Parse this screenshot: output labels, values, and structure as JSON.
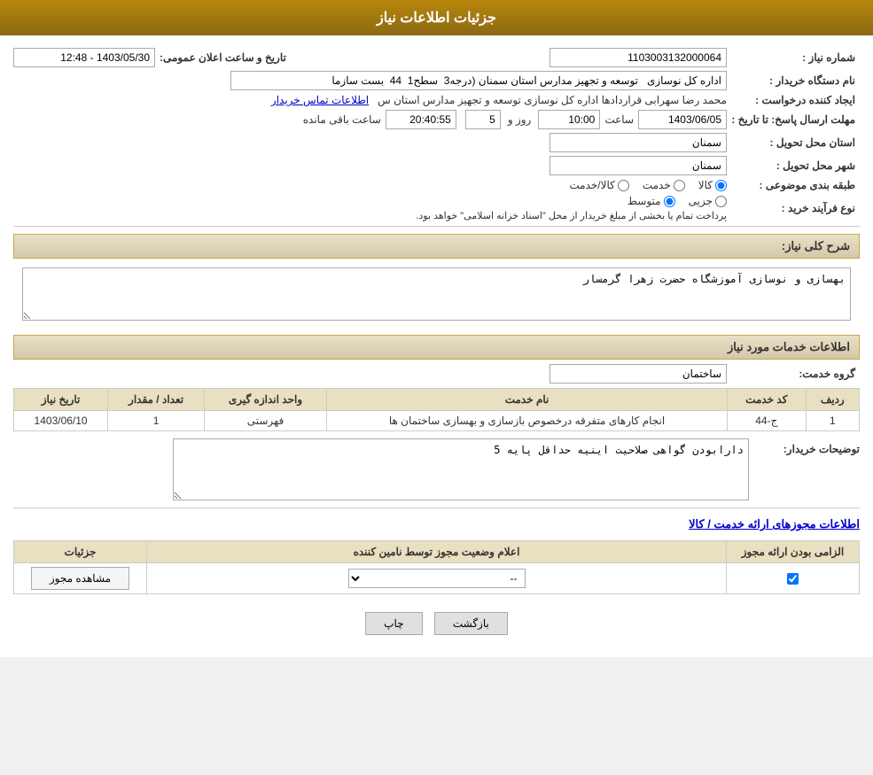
{
  "header": {
    "title": "جزئیات اطلاعات نیاز"
  },
  "fields": {
    "request_number_label": "شماره نیاز :",
    "request_number_value": "1103003132000064",
    "buyer_label": "نام دستگاه خریدار :",
    "buyer_value": "اداره کل نوسازی   توسعه و تجهیز مدارس استان سمنان (درجه3  سطح1  44  بست سازما",
    "creator_label": "ایجاد کننده درخواست :",
    "creator_value": "محمد رضا سهرابی قراردادها اداره کل نوسازی   توسعه و تجهیز مدارس استان س",
    "creator_link": "اطلاعات تماس خریدار",
    "deadline_label": "مهلت ارسال پاسخ: تا تاریخ :",
    "announce_date_label": "تاریخ و ساعت اعلان عمومی:",
    "announce_date_value": "1403/05/30 - 12:48",
    "deadline_date": "1403/06/05",
    "deadline_time": "10:00",
    "deadline_day": "5",
    "deadline_clock": "20:40:55",
    "remaining_label": "ساعت باقی مانده",
    "province_label": "استان محل تحویل :",
    "province_value": "سمنان",
    "city_label": "شهر محل تحویل :",
    "city_value": "سمنان",
    "category_label": "طبقه بندی موضوعی :",
    "category_options": [
      "کالا",
      "خدمت",
      "کالا/خدمت"
    ],
    "category_selected": "کالا",
    "process_label": "نوع فرآیند خرید :",
    "process_options": [
      "جزیی",
      "متوسط"
    ],
    "process_note": "پرداخت تمام یا بخشی از مبلغ خریدار از محل \"اسناد خزانه اسلامی\" خواهد بود.",
    "description_section": "شرح کلی نیاز:",
    "description_value": "بهسازی و نوسازی آموزشگاه حضرت زهرا گرمسار",
    "services_section": "اطلاعات خدمات مورد نیاز",
    "service_group_label": "گروه خدمت:",
    "service_group_value": "ساختمان",
    "table_headers": {
      "row_num": "ردیف",
      "service_code": "کد خدمت",
      "service_name": "نام خدمت",
      "unit": "واحد اندازه گیری",
      "quantity": "تعداد / مقدار",
      "date": "تاریخ نیاز"
    },
    "table_data": [
      {
        "row": "1",
        "code": "ج-44",
        "name": "انجام کارهای متفرقه درخصوص بازسازی و بهسازی ساختمان ها",
        "unit": "فهرستی",
        "quantity": "1",
        "date": "1403/06/10"
      }
    ],
    "buyer_desc_label": "توضیحات خریدار:",
    "buyer_desc_value": "دارابودن گواهی صلاحیت اینیه حداقل پایه 5",
    "permissions_section": "اطلاعات مجوزهای ارائه خدمت / کالا",
    "perm_table_headers": {
      "mandatory": "الزامی بودن ارائه مجوز",
      "status": "اعلام وضعیت مجوز توسط نامین کننده",
      "details": "جزئیات"
    },
    "perm_table_data": [
      {
        "mandatory": true,
        "status": "--",
        "details": "مشاهده مجوز"
      }
    ]
  },
  "buttons": {
    "print": "چاپ",
    "back": "بازگشت"
  }
}
